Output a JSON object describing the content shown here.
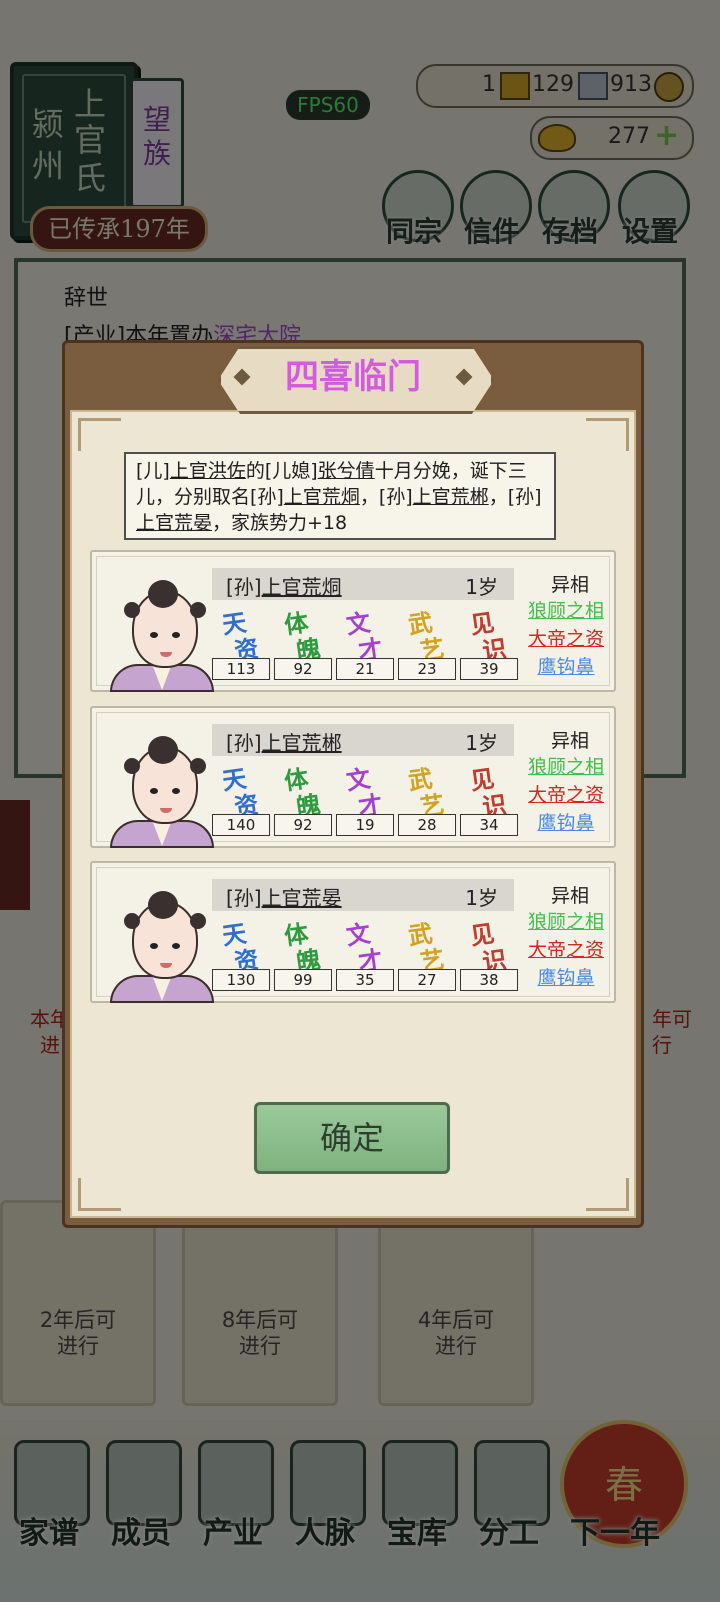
{
  "clan": {
    "prefecture_col1": "颍",
    "prefecture_col2": "州",
    "surname_col1": "上官",
    "surname_col2": "氏",
    "rank_tag": "望族",
    "inherited_label": "已传承197年"
  },
  "fps_label": "FPS60",
  "resources": {
    "gold_bars": "1",
    "silver": "129",
    "coins": "913",
    "ingots": "277"
  },
  "top_menu": [
    {
      "label": "同宗",
      "icon": "clan-book-icon"
    },
    {
      "label": "信件",
      "icon": "letter-icon"
    },
    {
      "label": "存档",
      "icon": "brush-icon"
    },
    {
      "label": "设置",
      "icon": "gear-icon"
    }
  ],
  "log": {
    "line1": "辞世",
    "line2_prefix": "[产业]本年置办",
    "line2_link": "深宅大院"
  },
  "background_cards": {
    "left_text_1": "本年",
    "left_text_2": "进",
    "right_text_1": "年可",
    "right_text_2": "行",
    "card1_text_1": "2年后可",
    "card1_text_2": "进行",
    "card2_text_1": "8年后可",
    "card2_text_2": "进行",
    "card3_text_1": "4年后可",
    "card3_text_2": "进行"
  },
  "bottom_nav": [
    {
      "label": "家谱",
      "icon": "family-tree-icon"
    },
    {
      "label": "成员",
      "icon": "member-icon"
    },
    {
      "label": "产业",
      "icon": "property-icon"
    },
    {
      "label": "人脉",
      "icon": "network-icon"
    },
    {
      "label": "宝库",
      "icon": "treasury-icon"
    },
    {
      "label": "分工",
      "icon": "scroll-icon"
    },
    {
      "label": "下一年",
      "icon": "lantern-icon"
    }
  ],
  "next_year_badge": "春",
  "modal": {
    "title": "四喜临门",
    "message": {
      "p1": "[儿]",
      "u1": "上官洪佐",
      "p2": "的[儿媳]",
      "u2": "张兮倩",
      "p3": "十月分娩，诞下三儿，分别取名[孙]",
      "u3": "上官荒烔",
      "p4": "，[孙]",
      "u4": "上官荒郴",
      "p5": "，[孙]",
      "u5": "上官荒晏",
      "p6": "，家族势力+18"
    },
    "stat_labels": [
      {
        "a": "天",
        "b": "资",
        "color": "#2f6fd0"
      },
      {
        "a": "体",
        "b": "魄",
        "color": "#2f9a3e"
      },
      {
        "a": "文",
        "b": "才",
        "color": "#a43fd0"
      },
      {
        "a": "武",
        "b": "艺",
        "color": "#d3a21f"
      },
      {
        "a": "见",
        "b": "识",
        "color": "#c23b2f"
      }
    ],
    "trait_header": "异相",
    "children": [
      {
        "prefix": "[孙]",
        "name": "上官荒烔",
        "age": "1岁",
        "stats": [
          "113",
          "92",
          "21",
          "23",
          "39"
        ],
        "traits": [
          {
            "label": "狼顾之相",
            "color": "#3fc24a"
          },
          {
            "label": "大帝之资",
            "color": "#d8261f"
          },
          {
            "label": "鹰钩鼻",
            "color": "#4a8be0"
          }
        ]
      },
      {
        "prefix": "[孙]",
        "name": "上官荒郴",
        "age": "1岁",
        "stats": [
          "140",
          "92",
          "19",
          "28",
          "34"
        ],
        "traits": [
          {
            "label": "狼顾之相",
            "color": "#3fc24a"
          },
          {
            "label": "大帝之资",
            "color": "#d8261f"
          },
          {
            "label": "鹰钩鼻",
            "color": "#4a8be0"
          }
        ]
      },
      {
        "prefix": "[孙]",
        "name": "上官荒晏",
        "age": "1岁",
        "stats": [
          "130",
          "99",
          "35",
          "27",
          "38"
        ],
        "traits": [
          {
            "label": "狼顾之相",
            "color": "#3fc24a"
          },
          {
            "label": "大帝之资",
            "color": "#d8261f"
          },
          {
            "label": "鹰钩鼻",
            "color": "#4a8be0"
          }
        ]
      }
    ],
    "confirm_label": "确定"
  }
}
